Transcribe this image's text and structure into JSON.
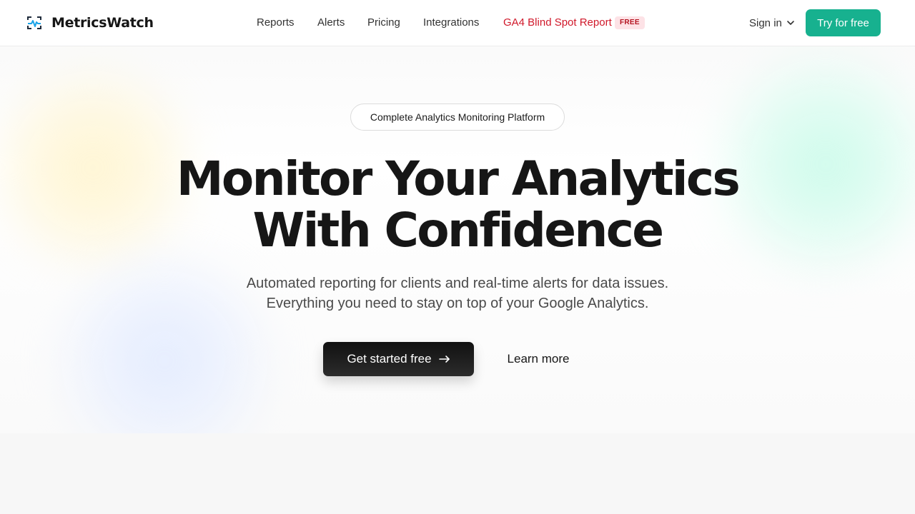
{
  "brand": {
    "name": "MetricsWatch",
    "logo_icon": "pulse-monitor-icon",
    "accent": "#17b18f"
  },
  "nav": {
    "links": [
      {
        "label": "Reports"
      },
      {
        "label": "Alerts"
      },
      {
        "label": "Pricing"
      },
      {
        "label": "Integrations"
      }
    ],
    "highlight": {
      "label": "GA4 Blind Spot Report",
      "badge": "FREE",
      "color": "#d0182a"
    },
    "signin_label": "Sign in",
    "cta_label": "Try for free"
  },
  "hero": {
    "pill": "Complete Analytics Monitoring Platform",
    "headline_line1": "Monitor Your Analytics",
    "headline_line2": "With Confidence",
    "sub_line1": "Automated reporting for clients and real-time alerts for data issues.",
    "sub_line2": "Everything you need to stay on top of your Google Analytics.",
    "primary_cta": "Get started free",
    "primary_cta_icon": "arrow-right-icon",
    "secondary_cta": "Learn more"
  }
}
